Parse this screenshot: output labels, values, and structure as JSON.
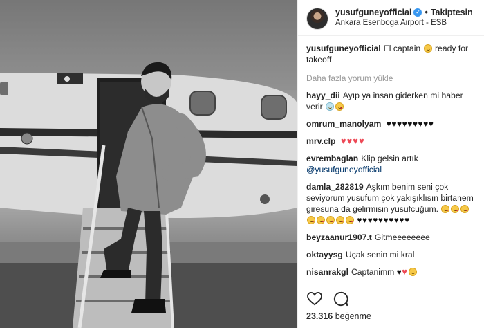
{
  "post": {
    "username": "yusufguneyofficial",
    "follow_label": "Takiptesin",
    "location": "Ankara Esenboga Airport - ESB",
    "dot": "•"
  },
  "caption": {
    "username": "yusufguneyofficial",
    "text": "El captain",
    "text_after": "ready for takeoff"
  },
  "load_more": "Daha fazla yorum yükle",
  "comments": [
    {
      "user": "hayy_dii",
      "text": "Ayıp ya insan giderken mi haber verir"
    },
    {
      "user": "omrum_manolyam",
      "text": ""
    },
    {
      "user": "mrv.clp",
      "text": ""
    },
    {
      "user": "evrembaglan",
      "text": "Klip gelsin artık",
      "mention": "@yusufguneyofficial"
    },
    {
      "user": "damla_282819",
      "text": "Aşkım benim seni çok seviyorum yusufum çok yakışıklısın birtanem giresuna da gelirmisin yusufcuğum."
    },
    {
      "user": "beyzaanur1907.t",
      "text": "Gitmeeeeeeee"
    },
    {
      "user": "oktayysg",
      "text": "Uçak senin mi kral"
    },
    {
      "user": "nisanrakgl",
      "text": "Captanimm"
    }
  ],
  "hearts": {
    "omrum_black": "♥♥♥♥♥♥♥♥♥",
    "mrv_red": "♥♥♥♥",
    "damla_black": "♥♥♥♥♥♥♥♥♥♥",
    "nisan": "♥"
  },
  "likes": {
    "count": "23.316",
    "label": "beğenme"
  },
  "colors": {
    "verified": "#3897f0",
    "heart_red": "#ed4956",
    "mention": "#003569"
  },
  "icons": {
    "verified": "verified-badge-icon",
    "like": "heart-outline-icon",
    "comment": "comment-bubble-icon"
  }
}
